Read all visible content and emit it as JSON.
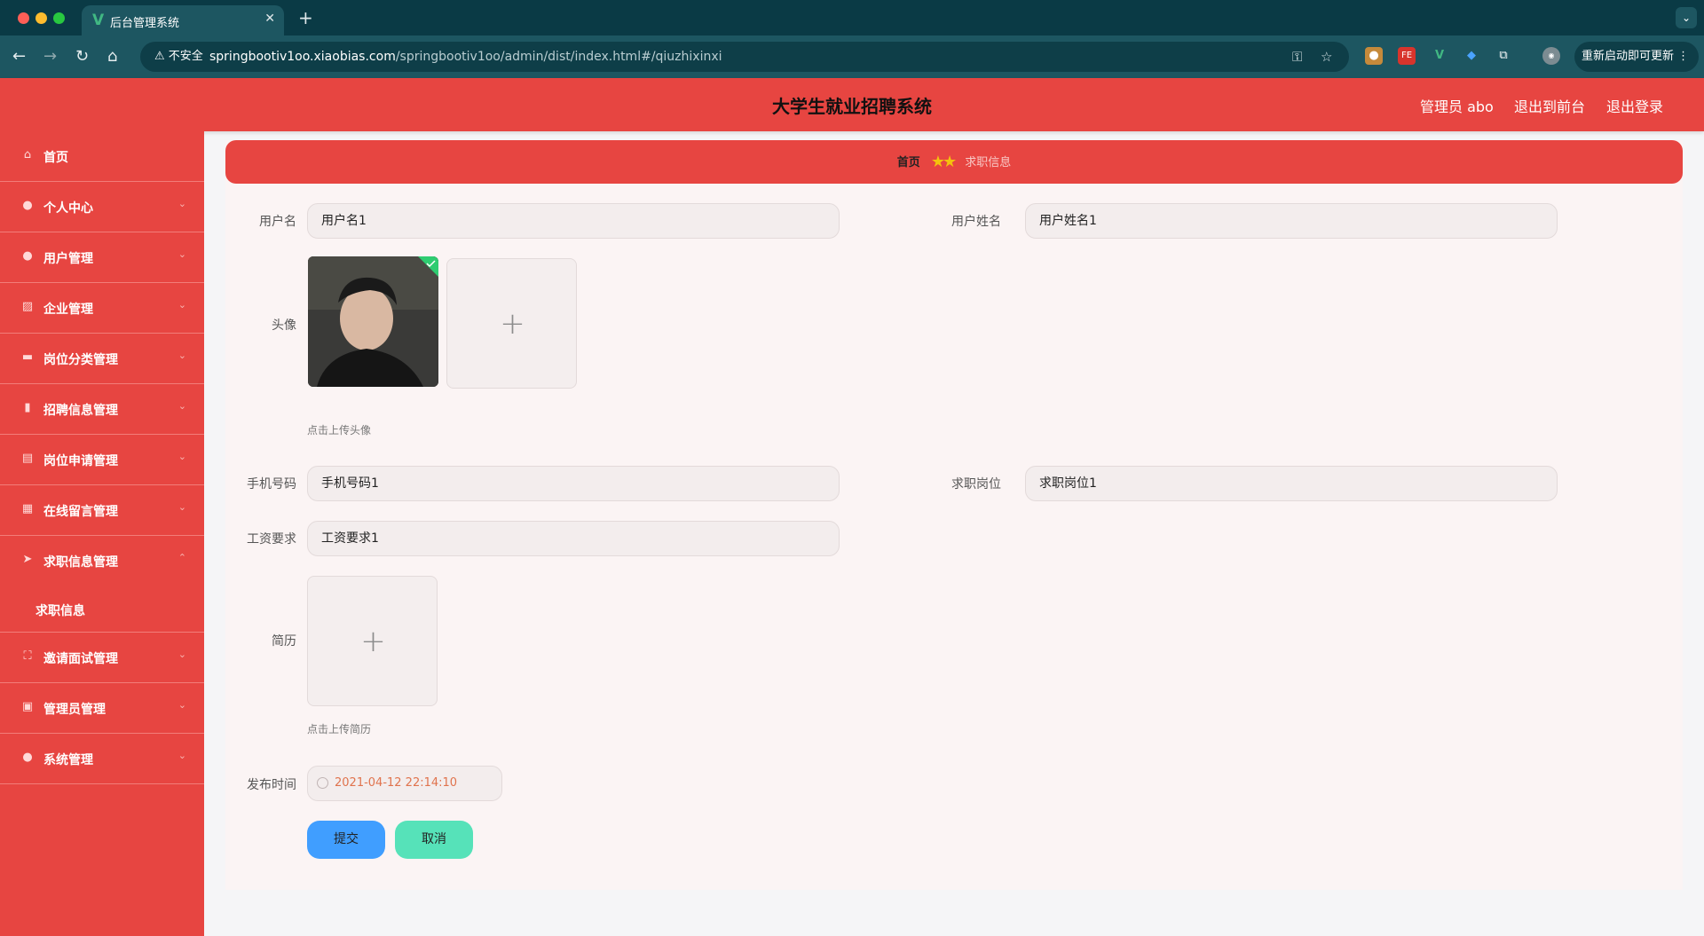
{
  "browser": {
    "tab_title": "后台管理系统",
    "tab_icon": "V",
    "address_insecure_label": "不安全",
    "url_host": "springbootiv1oo.xiaobias.com",
    "url_path": "/springbootiv1oo/admin/dist/index.html#/qiuzhixinxi",
    "update_button": "重新启动即可更新"
  },
  "header": {
    "title": "大学生就业招聘系统",
    "admin_label": "管理员 abo",
    "to_frontend": "退出到前台",
    "logout": "退出登录"
  },
  "sidebar": {
    "items": [
      {
        "label": "首页",
        "icon": "home-icon"
      },
      {
        "label": "个人中心",
        "icon": "user-icon"
      },
      {
        "label": "用户管理",
        "icon": "user-icon"
      },
      {
        "label": "企业管理",
        "icon": "chart-icon"
      },
      {
        "label": "岗位分类管理",
        "icon": "monitor-icon"
      },
      {
        "label": "招聘信息管理",
        "icon": "bar-chart-icon"
      },
      {
        "label": "岗位申请管理",
        "icon": "briefcase-icon"
      },
      {
        "label": "在线留言管理",
        "icon": "grid-icon"
      },
      {
        "label": "求职信息管理",
        "icon": "send-icon"
      },
      {
        "label": "邀请面试管理",
        "icon": "fullscreen-icon"
      },
      {
        "label": "管理员管理",
        "icon": "delete-icon"
      },
      {
        "label": "系统管理",
        "icon": "location-icon"
      }
    ],
    "subitem": "求职信息"
  },
  "breadcrumb": {
    "home": "首页",
    "separator": "★★",
    "current": "求职信息"
  },
  "form": {
    "username_label": "用户名",
    "username_value": "用户名1",
    "realname_label": "用户姓名",
    "realname_value": "用户姓名1",
    "avatar_label": "头像",
    "avatar_tip": "点击上传头像",
    "phone_label": "手机号码",
    "phone_value": "手机号码1",
    "position_label": "求职岗位",
    "position_value": "求职岗位1",
    "salary_label": "工资要求",
    "salary_value": "工资要求1",
    "resume_label": "简历",
    "resume_tip": "点击上传简历",
    "publish_label": "发布时间",
    "publish_value": "2021-04-12 22:14:10",
    "submit": "提交",
    "cancel": "取消"
  },
  "colors": {
    "brand": "#e74541",
    "submit": "#409eff",
    "cancel": "#56e2b9"
  }
}
